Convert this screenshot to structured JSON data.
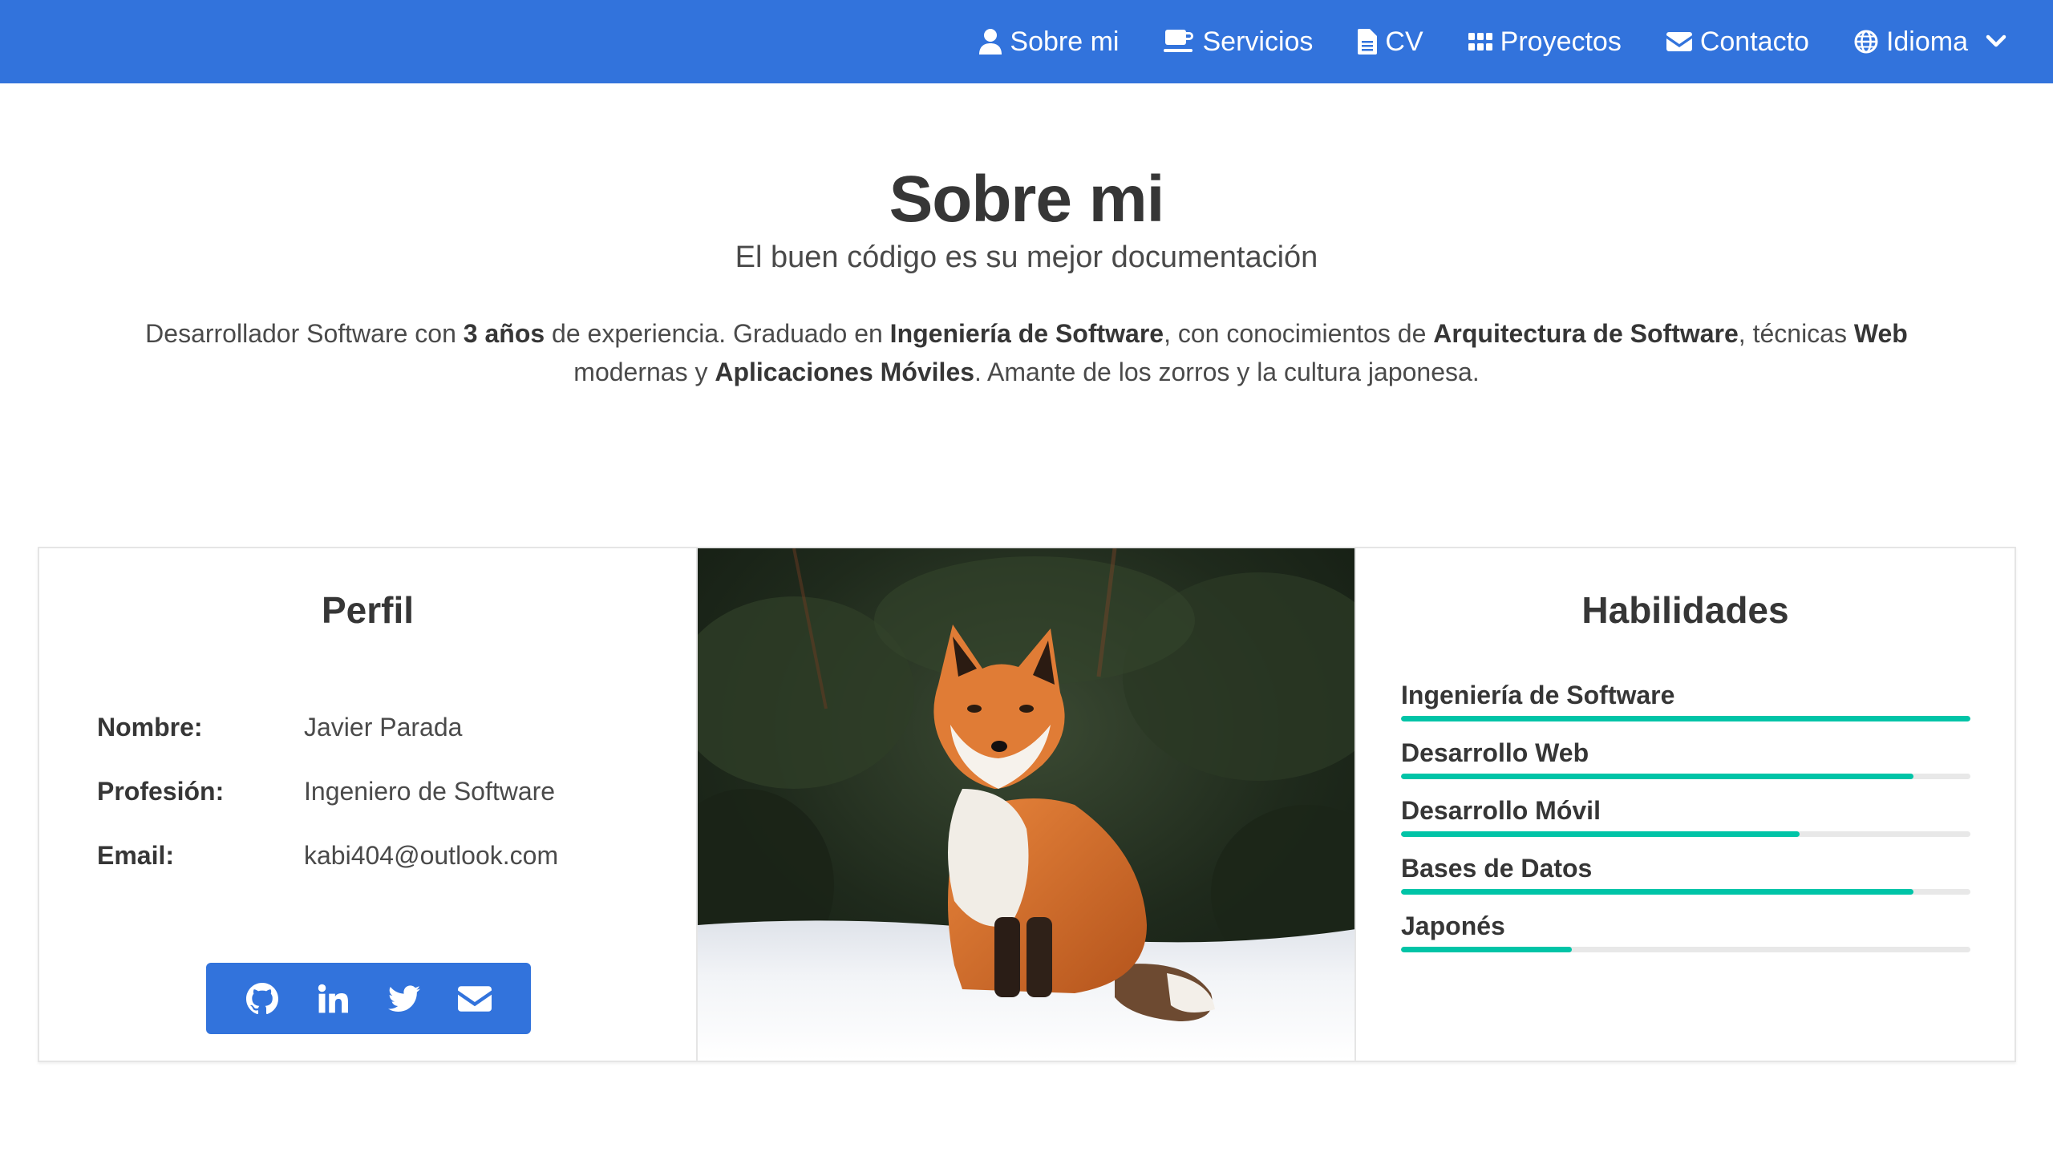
{
  "nav": {
    "items": [
      {
        "id": "about",
        "label": "Sobre mi",
        "icon": "user-icon"
      },
      {
        "id": "services",
        "label": "Servicios",
        "icon": "coffee-icon"
      },
      {
        "id": "cv",
        "label": "CV",
        "icon": "file-icon"
      },
      {
        "id": "projects",
        "label": "Proyectos",
        "icon": "grid-icon"
      },
      {
        "id": "contact",
        "label": "Contacto",
        "icon": "envelope-icon"
      },
      {
        "id": "language",
        "label": "Idioma",
        "icon": "globe-icon"
      }
    ]
  },
  "hero": {
    "title": "Sobre mi",
    "subtitle": "El buen código es su mejor documentación",
    "intro": [
      {
        "text": "Desarrollador Software con ",
        "bold": false
      },
      {
        "text": "3 años",
        "bold": true
      },
      {
        "text": " de experiencia. Graduado en ",
        "bold": false
      },
      {
        "text": "Ingeniería de Software",
        "bold": true
      },
      {
        "text": ", con conocimientos de ",
        "bold": false
      },
      {
        "text": "Arquitectura de Software",
        "bold": true
      },
      {
        "text": ", técnicas ",
        "bold": false
      },
      {
        "text": "Web",
        "bold": true
      },
      {
        "text": " modernas y ",
        "bold": false
      },
      {
        "text": "Aplicaciones Móviles",
        "bold": true
      },
      {
        "text": ". Amante de los zorros y la cultura japonesa.",
        "bold": false
      }
    ]
  },
  "profile": {
    "title": "Perfil",
    "rows": [
      {
        "label": "Nombre:",
        "value": "Javier Parada"
      },
      {
        "label": "Profesión:",
        "value": "Ingeniero de Software"
      },
      {
        "label": "Email:",
        "value": "kabi404@outlook.com"
      }
    ],
    "social": [
      "github-icon",
      "linkedin-icon",
      "twitter-icon",
      "envelope-icon"
    ]
  },
  "photo": {
    "subject": "fox-photo"
  },
  "skills": {
    "title": "Habilidades",
    "items": [
      {
        "name": "Ingeniería de Software",
        "level": 1.0
      },
      {
        "name": "Desarrollo Web",
        "level": 0.9
      },
      {
        "name": "Desarrollo Móvil",
        "level": 0.7
      },
      {
        "name": "Bases de Datos",
        "level": 0.9
      },
      {
        "name": "Japonés",
        "level": 0.3
      }
    ],
    "bar_color": "#00c4a7"
  },
  "colors": {
    "primary": "#3273dc",
    "accent": "#00c4a7"
  }
}
